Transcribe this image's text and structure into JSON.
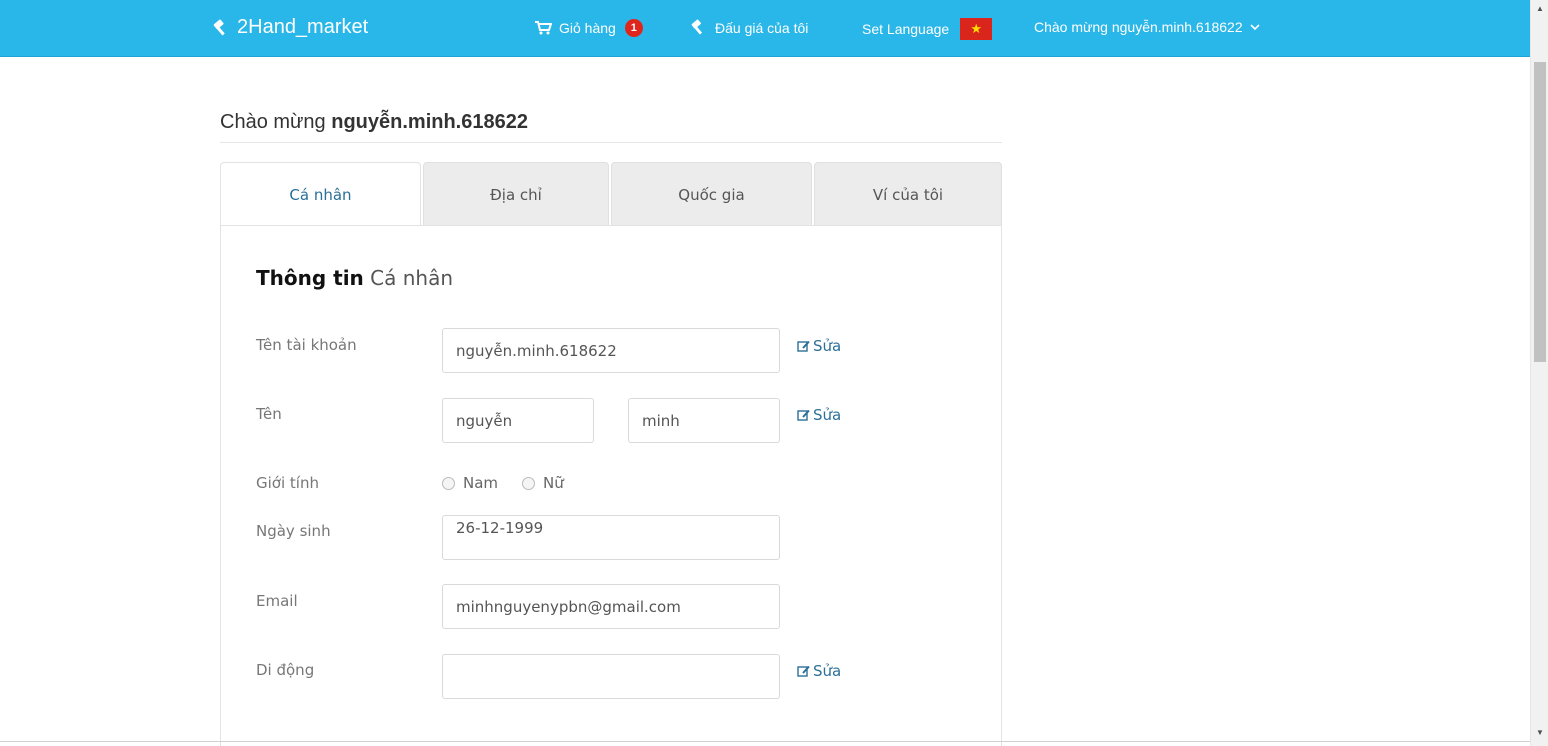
{
  "navbar": {
    "brand": "2Hand_market",
    "cart_label": "Giỏ hàng",
    "cart_count": "1",
    "auction_label": "Đấu giá của tôi",
    "language_label": "Set Language",
    "language_flag": "vietnam-flag",
    "user_greeting": "Chào mừng nguyễn.minh.618622",
    "colors": {
      "bar": "#29b6e8",
      "badge": "#e0261c"
    }
  },
  "welcome": {
    "prefix": "Chào mừng",
    "username": "nguyễn.minh.618622"
  },
  "tabs": [
    {
      "label": "Cá nhân",
      "active": true
    },
    {
      "label": "Địa chỉ",
      "active": false
    },
    {
      "label": "Quốc gia",
      "active": false
    },
    {
      "label": "Ví của tôi",
      "active": false
    }
  ],
  "profile": {
    "title_bold": "Thông tin",
    "title_rest": "Cá nhân",
    "edit_label": "Sửa",
    "account": {
      "label": "Tên tài khoản",
      "value": "nguyễn.minh.618622"
    },
    "name": {
      "label": "Tên",
      "first": "nguyễn",
      "last": "minh"
    },
    "gender": {
      "label": "Giới tính",
      "options": [
        "Nam",
        "Nữ"
      ]
    },
    "birthday": {
      "label": "Ngày sinh",
      "value": "26-12-1999"
    },
    "email": {
      "label": "Email",
      "value": "minhnguyenypbn@gmail.com"
    },
    "mobile": {
      "label": "Di động",
      "value": ""
    }
  }
}
